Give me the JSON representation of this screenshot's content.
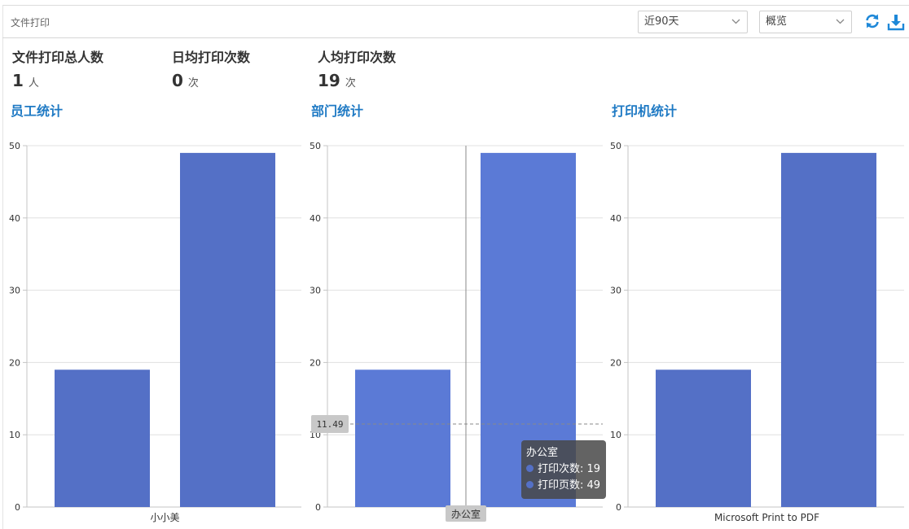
{
  "header": {
    "title": "文件打印",
    "range_select": "近90天",
    "view_select": "概览",
    "icons": [
      "refresh-icon",
      "download-icon"
    ]
  },
  "stats": [
    {
      "label": "文件打印总人数",
      "value": "1",
      "unit": "人"
    },
    {
      "label": "日均打印次数",
      "value": "0",
      "unit": "次"
    },
    {
      "label": "人均打印次数",
      "value": "19",
      "unit": "次"
    }
  ],
  "colors": {
    "bar": "#5470c6",
    "bar_hover": "#5b7ad6",
    "title": "#1f7ac4",
    "grid": "#e0e0e0"
  },
  "chart_data": [
    {
      "type": "bar",
      "title": "员工统计",
      "categories": [
        "小小美"
      ],
      "series": [
        {
          "name": "打印次数",
          "values": [
            19
          ]
        },
        {
          "name": "打印页数",
          "values": [
            49
          ]
        }
      ],
      "ylim": [
        0,
        50
      ],
      "yticks": [
        0,
        10,
        20,
        30,
        40,
        50
      ],
      "grid": true
    },
    {
      "type": "bar",
      "title": "部门统计",
      "categories": [
        "办公室"
      ],
      "series": [
        {
          "name": "打印次数",
          "values": [
            19
          ]
        },
        {
          "name": "打印页数",
          "values": [
            49
          ]
        }
      ],
      "ylim": [
        0,
        50
      ],
      "yticks": [
        0,
        10,
        20,
        30,
        40,
        50
      ],
      "grid": true,
      "pointer": {
        "y_value": 11.49,
        "y_label": "11.49",
        "x_label": "办公室"
      },
      "tooltip": {
        "title": "办公室",
        "rows": [
          "打印次数: 19",
          "打印页数: 49"
        ]
      }
    },
    {
      "type": "bar",
      "title": "打印机统计",
      "categories": [
        "Microsoft Print to PDF"
      ],
      "series": [
        {
          "name": "打印次数",
          "values": [
            19
          ]
        },
        {
          "name": "打印页数",
          "values": [
            49
          ]
        }
      ],
      "ylim": [
        0,
        50
      ],
      "yticks": [
        0,
        10,
        20,
        30,
        40,
        50
      ],
      "grid": true
    }
  ]
}
